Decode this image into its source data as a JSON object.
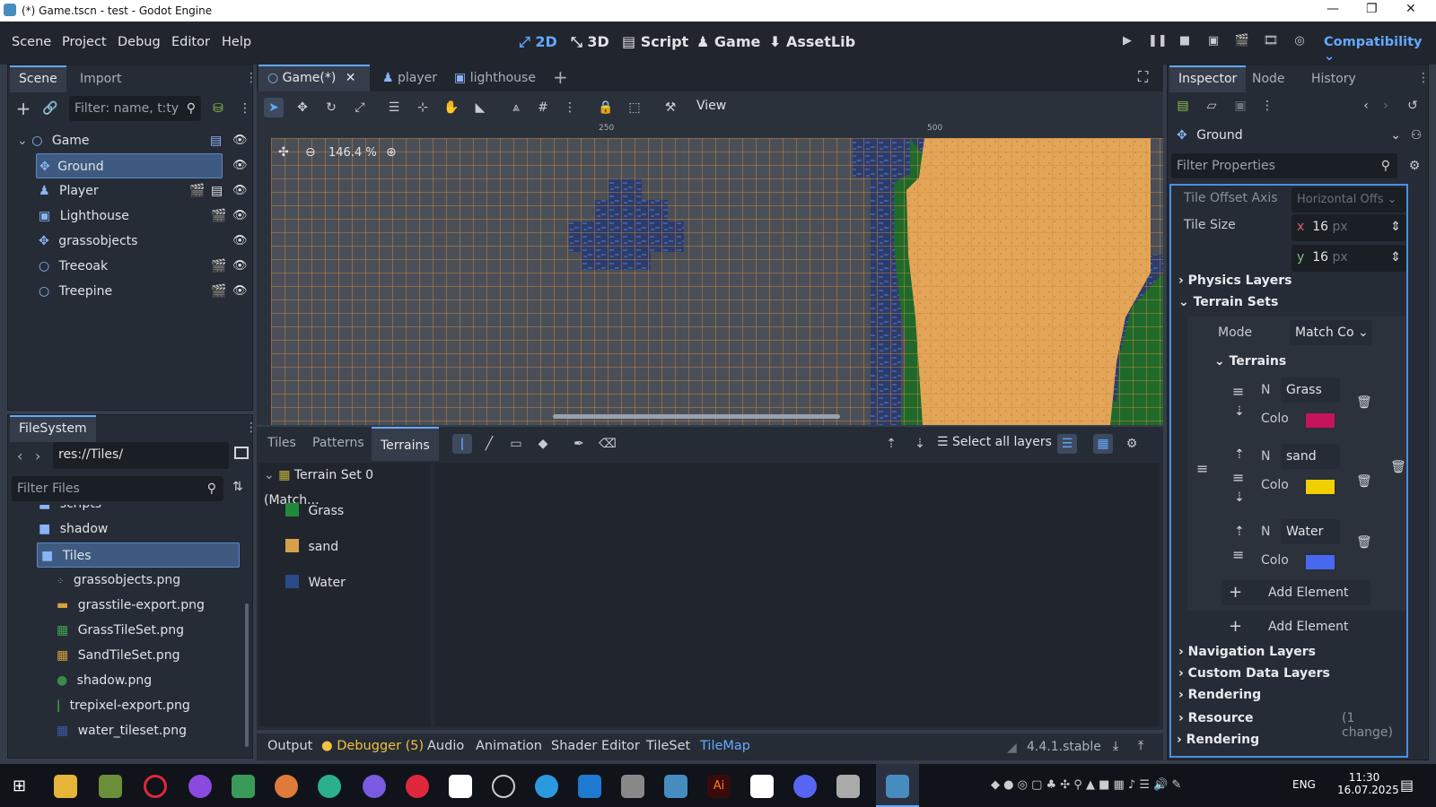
{
  "window": {
    "title": "(*) Game.tscn - test - Godot Engine"
  },
  "menu": [
    "Scene",
    "Project",
    "Debug",
    "Editor",
    "Help"
  ],
  "modes": [
    "2D",
    "3D",
    "Script",
    "Game",
    "AssetLib"
  ],
  "renderer": "Compatibility",
  "scene_dock": {
    "tabs": [
      "Scene",
      "Import"
    ],
    "filter_placeholder": "Filter: name, t:ty",
    "nodes": [
      {
        "label": "Game",
        "icon": "node2d-icon"
      },
      {
        "label": "Ground",
        "icon": "tilemap-icon"
      },
      {
        "label": "Player",
        "icon": "character-icon"
      },
      {
        "label": "Lighthouse",
        "icon": "sprite-icon"
      },
      {
        "label": "grassobjects",
        "icon": "tilemap-icon"
      },
      {
        "label": "Treeoak",
        "icon": "node2d-icon"
      },
      {
        "label": "Treepine",
        "icon": "node2d-icon"
      }
    ]
  },
  "filesystem": {
    "tab": "FileSystem",
    "path": "res://Tiles/",
    "filter_placeholder": "Filter Files",
    "items": [
      {
        "label": "scripts",
        "type": "folder"
      },
      {
        "label": "shadow",
        "type": "folder"
      },
      {
        "label": "Tiles",
        "type": "folder"
      },
      {
        "label": "grassobjects.png",
        "type": "file"
      },
      {
        "label": "grasstile-export.png",
        "type": "file"
      },
      {
        "label": "GrassTileSet.png",
        "type": "file"
      },
      {
        "label": "SandTileSet.png",
        "type": "file"
      },
      {
        "label": "shadow.png",
        "type": "file"
      },
      {
        "label": "trepixel-export.png",
        "type": "file"
      },
      {
        "label": "water_tileset.png",
        "type": "file"
      }
    ]
  },
  "editor_tabs": [
    "Game(*)",
    "player",
    "lighthouse"
  ],
  "toolbar": {
    "view_label": "View"
  },
  "viewport": {
    "zoom": "146.4 %",
    "ruler_marks": [
      "250",
      "500"
    ]
  },
  "tilemap_panel": {
    "tabs": [
      "Tiles",
      "Patterns",
      "Terrains"
    ],
    "select_all_layers": "Select all layers",
    "terrain_set": "Terrain Set 0 (Match...",
    "terrains": [
      {
        "name": "Grass",
        "color": "#1f8a3a"
      },
      {
        "name": "sand",
        "color": "#d8a04a"
      },
      {
        "name": "Water",
        "color": "#2a4a8a"
      }
    ]
  },
  "bottom_bar": {
    "tabs": [
      "Output",
      "Debugger (5)",
      "Audio",
      "Animation",
      "Shader Editor",
      "TileSet",
      "TileMap"
    ],
    "version": "4.4.1.stable"
  },
  "inspector": {
    "tabs": [
      "Inspector",
      "Node",
      "History"
    ],
    "node": "Ground",
    "filter_placeholder": "Filter Properties",
    "tile_offset_axis": {
      "label": "Tile Offset Axis",
      "value": "Horizontal Offs"
    },
    "tile_size": {
      "label": "Tile Size",
      "x": "16",
      "y": "16",
      "unit": "px"
    },
    "sections": {
      "physics": "Physics Layers",
      "terrain_sets": "Terrain Sets",
      "terrains": "Terrains",
      "navigation": "Navigation Layers",
      "custom": "Custom Data Layers",
      "rendering": "Rendering",
      "resource": "Resource",
      "resource_note": "(1 change)",
      "rendering2": "Rendering"
    },
    "mode": {
      "label": "Mode",
      "value": "Match Co"
    },
    "terrain_entries": [
      {
        "name": "Grass",
        "color": "#c4145c"
      },
      {
        "name": "sand",
        "color": "#f0d000"
      },
      {
        "name": "Water",
        "color": "#4868f0"
      }
    ],
    "n_label": "N",
    "color_label": "Colo",
    "add_element": "Add Element"
  },
  "taskbar": {
    "lang": "ENG",
    "time": "11:30",
    "date": "16.07.2025"
  }
}
